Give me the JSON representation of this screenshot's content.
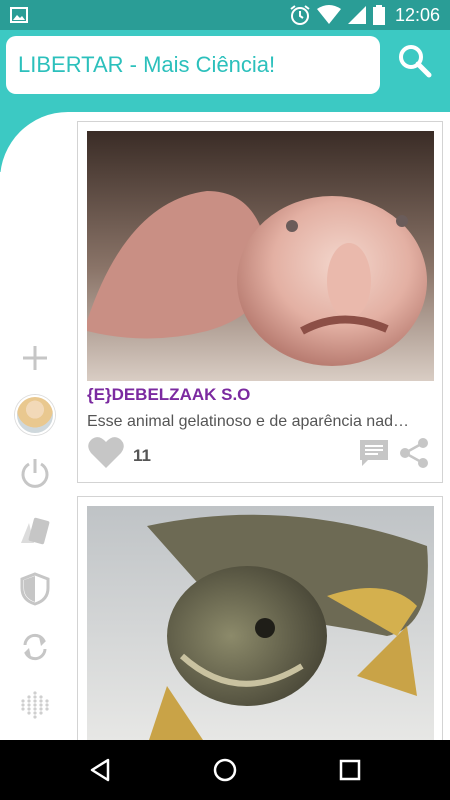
{
  "status_bar": {
    "time": "12:06",
    "icons": [
      "gallery-icon",
      "alarm-icon",
      "wifi-icon",
      "signal-icon",
      "battery-icon"
    ]
  },
  "header": {
    "search_text": "LIBERTAR - Mais Ciência!",
    "search_icon": "search-icon",
    "accent_color": "#3cc9c3"
  },
  "sidebar": {
    "items": [
      "add-icon",
      "avatar",
      "power-icon",
      "cards-icon",
      "shield-icon",
      "refresh-icon",
      "dots-icon"
    ]
  },
  "posts": [
    {
      "author": "{E}DEBELZAAK S.O",
      "description": "Esse animal gelatinoso e de aparência nad…",
      "likes": "11",
      "image": "blobfish-photo"
    },
    {
      "author": "",
      "description": "",
      "likes": "",
      "image": "fish-photo"
    }
  ],
  "nav_bar": {
    "buttons": [
      "back-icon",
      "home-icon",
      "recents-icon"
    ]
  }
}
